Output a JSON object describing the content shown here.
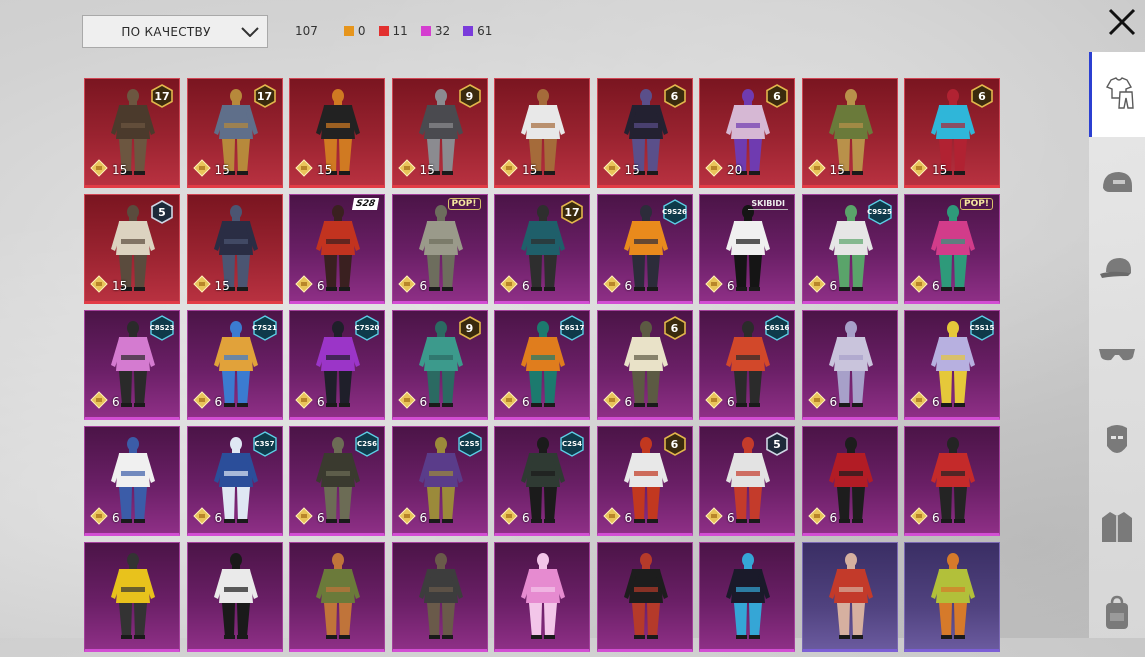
{
  "sort": {
    "label": "ПО КАЧЕСТВУ"
  },
  "counts": {
    "total": "107",
    "items": [
      {
        "value": "0",
        "color": "#e6951c"
      },
      {
        "value": "11",
        "color": "#e2302f"
      },
      {
        "value": "32",
        "color": "#d53ed0"
      },
      {
        "value": "61",
        "color": "#7a3bdb"
      }
    ]
  },
  "sidebar": {
    "items": [
      {
        "name": "outfit-icon",
        "active": true
      },
      {
        "name": "helmet-icon"
      },
      {
        "name": "cap-icon"
      },
      {
        "name": "glasses-icon"
      },
      {
        "name": "mask-icon"
      },
      {
        "name": "jacket-icon"
      },
      {
        "name": "backpack-icon"
      }
    ]
  },
  "cards": [
    {
      "rarity": "red",
      "qty": "15",
      "badge": "17",
      "badgeType": "num",
      "colors": [
        "#4b3a2c",
        "#6c5640"
      ]
    },
    {
      "rarity": "red",
      "qty": "15",
      "badge": "17",
      "badgeType": "num",
      "colors": [
        "#5f6f8a",
        "#b7893b"
      ]
    },
    {
      "rarity": "red",
      "qty": "15",
      "badge": "",
      "badgeType": "",
      "colors": [
        "#222",
        "#d07a22"
      ]
    },
    {
      "rarity": "red",
      "qty": "15",
      "badge": "9",
      "badgeType": "num",
      "colors": [
        "#4a4a4f",
        "#8b8b90"
      ]
    },
    {
      "rarity": "red",
      "qty": "15",
      "badge": "",
      "badgeType": "",
      "colors": [
        "#e8e8e8",
        "#a56b3a"
      ]
    },
    {
      "rarity": "red",
      "qty": "15",
      "badge": "6",
      "badgeType": "num",
      "colors": [
        "#232131",
        "#5a4f8a"
      ]
    },
    {
      "rarity": "red",
      "qty": "20",
      "badge": "6",
      "badgeType": "num",
      "colors": [
        "#d6b8d4",
        "#6f3bb0"
      ]
    },
    {
      "rarity": "red",
      "qty": "15",
      "badge": "",
      "badgeType": "",
      "colors": [
        "#6a7a3a",
        "#b9914a"
      ]
    },
    {
      "rarity": "red",
      "qty": "15",
      "badge": "6",
      "badgeType": "num",
      "colors": [
        "#2fb6d9",
        "#b12232"
      ]
    },
    {
      "rarity": "red",
      "qty": "15",
      "badge": "5",
      "badgeType": "num-dark",
      "colors": [
        "#dcd3c0",
        "#5a4b3d"
      ]
    },
    {
      "rarity": "red",
      "qty": "15",
      "badge": "",
      "badgeType": "",
      "colors": [
        "#2a2d44",
        "#4b5572"
      ]
    },
    {
      "rarity": "purple",
      "qty": "6",
      "badge": "S28",
      "badgeType": "text",
      "colors": [
        "#c2331f",
        "#3a2020"
      ]
    },
    {
      "rarity": "purple",
      "qty": "6",
      "badge": "POP!",
      "badgeType": "pop",
      "colors": [
        "#9a9a8a",
        "#6d6d5d"
      ]
    },
    {
      "rarity": "purple",
      "qty": "6",
      "badge": "17",
      "badgeType": "num",
      "colors": [
        "#1f5f6a",
        "#2e2e2e"
      ]
    },
    {
      "rarity": "purple",
      "qty": "6",
      "badge": "C9S26",
      "badgeType": "hex",
      "colors": [
        "#e98a1c",
        "#2c2c3a"
      ]
    },
    {
      "rarity": "purple",
      "qty": "6",
      "badge": "SKIBIDI",
      "badgeType": "logo",
      "colors": [
        "#f0f0f0",
        "#151515"
      ]
    },
    {
      "rarity": "purple",
      "qty": "6",
      "badge": "C9S25",
      "badgeType": "hex",
      "colors": [
        "#e6e6e6",
        "#5aa46a"
      ]
    },
    {
      "rarity": "purple",
      "qty": "6",
      "badge": "POP!",
      "badgeType": "pop",
      "colors": [
        "#d23c8a",
        "#2e9a7a"
      ]
    },
    {
      "rarity": "purple",
      "qty": "6",
      "badge": "C8S23",
      "badgeType": "hex",
      "colors": [
        "#d47bd0",
        "#2a2a2a"
      ]
    },
    {
      "rarity": "purple",
      "qty": "6",
      "badge": "C7S21",
      "badgeType": "hex",
      "colors": [
        "#e1a23a",
        "#3b7bd0"
      ]
    },
    {
      "rarity": "purple",
      "qty": "6",
      "badge": "C7S20",
      "badgeType": "hex",
      "colors": [
        "#9b35c8",
        "#1f1f2a"
      ]
    },
    {
      "rarity": "purple",
      "qty": "6",
      "badge": "9",
      "badgeType": "num",
      "colors": [
        "#3c9a8c",
        "#2b6a62"
      ]
    },
    {
      "rarity": "purple",
      "qty": "6",
      "badge": "C6S17",
      "badgeType": "hex",
      "colors": [
        "#e07d1d",
        "#1c7a6e"
      ]
    },
    {
      "rarity": "purple",
      "qty": "6",
      "badge": "6",
      "badgeType": "num",
      "colors": [
        "#e9e2c8",
        "#5c5a43"
      ]
    },
    {
      "rarity": "purple",
      "qty": "6",
      "badge": "C6S16",
      "badgeType": "hex",
      "colors": [
        "#d2482a",
        "#2b2b2b"
      ]
    },
    {
      "rarity": "purple",
      "qty": "6",
      "badge": "",
      "badgeType": "",
      "colors": [
        "#c9c4dc",
        "#a7a0c9"
      ]
    },
    {
      "rarity": "purple",
      "qty": "6",
      "badge": "C5S15",
      "badgeType": "hex",
      "colors": [
        "#b7b0e0",
        "#e5c83a"
      ]
    },
    {
      "rarity": "purple",
      "qty": "6",
      "badge": "",
      "badgeType": "",
      "colors": [
        "#f0f0f0",
        "#3b5ca8"
      ]
    },
    {
      "rarity": "purple",
      "qty": "6",
      "badge": "C3S7",
      "badgeType": "hex",
      "colors": [
        "#2b4e9a",
        "#dfe7f3"
      ]
    },
    {
      "rarity": "purple",
      "qty": "6",
      "badge": "C2S6",
      "badgeType": "hex",
      "colors": [
        "#3a3a2f",
        "#6c6c55"
      ]
    },
    {
      "rarity": "purple",
      "qty": "6",
      "badge": "C2S5",
      "badgeType": "hex",
      "colors": [
        "#5a3c8a",
        "#9b8a3a"
      ]
    },
    {
      "rarity": "purple",
      "qty": "6",
      "badge": "C2S4",
      "badgeType": "hex",
      "colors": [
        "#2f3a33",
        "#1b1b1b"
      ]
    },
    {
      "rarity": "purple",
      "qty": "6",
      "badge": "6",
      "badgeType": "num",
      "colors": [
        "#e8e8e8",
        "#c2381f"
      ]
    },
    {
      "rarity": "purple",
      "qty": "6",
      "badge": "5",
      "badgeType": "num-dark",
      "colors": [
        "#e3e3e3",
        "#c43b2b"
      ]
    },
    {
      "rarity": "purple",
      "qty": "6",
      "badge": "",
      "badgeType": "",
      "colors": [
        "#b21c25",
        "#1d1d1d"
      ]
    },
    {
      "rarity": "purple",
      "qty": "6",
      "badge": "",
      "badgeType": "",
      "colors": [
        "#c42a2a",
        "#242424"
      ]
    },
    {
      "rarity": "purple",
      "qty": "",
      "badge": "",
      "badgeType": "",
      "colors": [
        "#e8c21c",
        "#333"
      ]
    },
    {
      "rarity": "purple",
      "qty": "",
      "badge": "",
      "badgeType": "",
      "colors": [
        "#eaeaea",
        "#1a1a1a"
      ]
    },
    {
      "rarity": "purple",
      "qty": "",
      "badge": "",
      "badgeType": "",
      "colors": [
        "#6b7a3a",
        "#c0743a"
      ]
    },
    {
      "rarity": "purple",
      "qty": "",
      "badge": "",
      "badgeType": "",
      "colors": [
        "#3d3d3d",
        "#6a5a4a"
      ]
    },
    {
      "rarity": "purple",
      "qty": "",
      "badge": "",
      "badgeType": "",
      "colors": [
        "#e68bd0",
        "#f3c6e9"
      ]
    },
    {
      "rarity": "purple",
      "qty": "",
      "badge": "",
      "badgeType": "",
      "colors": [
        "#1d1d1d",
        "#b53a2a"
      ]
    },
    {
      "rarity": "purple",
      "qty": "",
      "badge": "",
      "badgeType": "",
      "colors": [
        "#1a1a2a",
        "#35a6d6"
      ]
    },
    {
      "rarity": "violet",
      "qty": "",
      "badge": "",
      "badgeType": "",
      "colors": [
        "#c33a2a",
        "#d6b0a0"
      ]
    },
    {
      "rarity": "violet",
      "qty": "",
      "badge": "",
      "badgeType": "",
      "colors": [
        "#b2c03a",
        "#d67a2a"
      ]
    }
  ]
}
